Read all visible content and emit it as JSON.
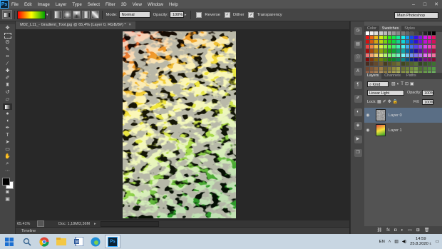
{
  "menu": {
    "logo": "Ps",
    "items": [
      "File",
      "Edit",
      "Image",
      "Layer",
      "Type",
      "Select",
      "Filter",
      "3D",
      "View",
      "Window",
      "Help"
    ]
  },
  "window_controls": {
    "minimize": "–",
    "maximize": "□",
    "close": "✕"
  },
  "options": {
    "mode_label": "Mode:",
    "mode_value": "Normal",
    "opacity_label": "Opacity:",
    "opacity_value": "100%",
    "reverse_label": "Reverse",
    "dither_label": "Dither",
    "transparency_label": "Transparency",
    "reverse_checked": false,
    "dither_checked": true,
    "transparency_checked": true
  },
  "workspace": "Main Photoshop",
  "document": {
    "tab_title": "M02_L11_- Gradient_Tool.jpg @ 65,4% (Layer 0, RGB/8#) *",
    "close": "×"
  },
  "status": {
    "zoom": "65.41%",
    "doc_info": "Doc: 1,18M/2,36M"
  },
  "timeline_label": "Timeline",
  "panels": {
    "top_tabs": [
      "Color",
      "Swatches",
      "Styles"
    ],
    "top_active": "Swatches",
    "layer_tabs": [
      "Layers",
      "Channels",
      "Paths"
    ],
    "layer_active": "Layers",
    "kind_label": "Kind",
    "blend_mode": "Linear Light",
    "opacity_label": "Opacity:",
    "opacity_value": "100%",
    "lock_label": "Lock:",
    "fill_label": "Fill:",
    "fill_value": "100%"
  },
  "layers": [
    {
      "name": "Layer 0",
      "selected": true
    },
    {
      "name": "Layer 1",
      "selected": false
    }
  ],
  "taskbar": {
    "language": "EN",
    "time": "14:59",
    "date": "25.8.2020 г."
  },
  "colors": {
    "accent": "#31a8ff",
    "panel_bg": "#535353",
    "selected_layer": "#5a6e85"
  }
}
